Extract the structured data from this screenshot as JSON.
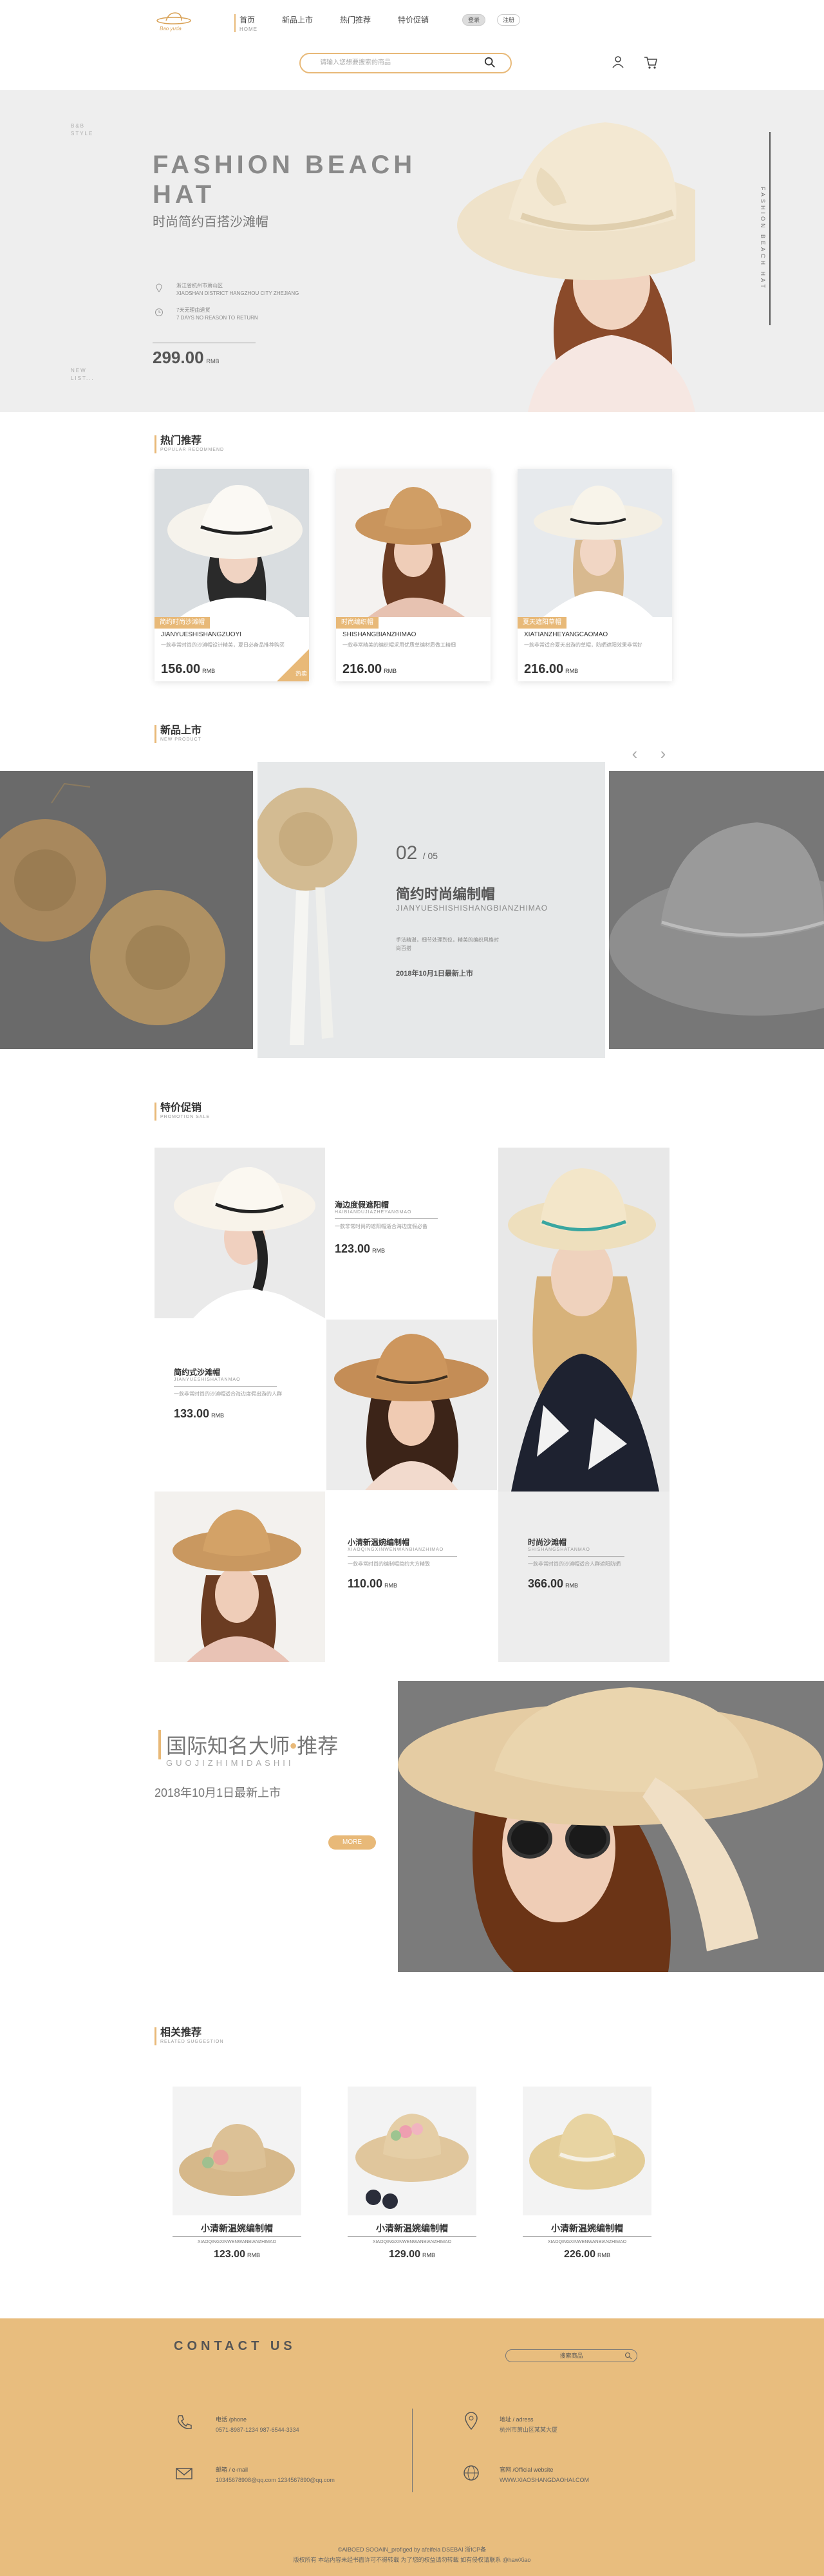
{
  "header": {
    "logo_text": "Bao yuda",
    "nav": [
      {
        "label": "首页",
        "sub": "HOME"
      },
      {
        "label": "新品上市"
      },
      {
        "label": "热门推荐"
      },
      {
        "label": "特价促销"
      }
    ],
    "lang": [
      "登录",
      "注册"
    ],
    "search_placeholder": "请输入您想要搜索的商品"
  },
  "hero": {
    "side_top": "B&B STYLE",
    "side_bottom": "NEW LIST...",
    "title": "FASHION BEACH HAT",
    "subtitle": "时尚简约百搭沙滩帽",
    "meta1_cn": "浙江省杭州市萧山区",
    "meta1_en": "XIAOSHAN DISTRICT HANGZHOU CITY ZHEJIANG",
    "meta2_cn": "7天无理由退货",
    "meta2_en": "7 DAYS NO REASON TO RETURN",
    "price": "299.00",
    "currency": "RMB",
    "vertical": "FASHION BEACH HAT"
  },
  "hot": {
    "title": "热门推荐",
    "sub": "POPULAR RECOMMEND",
    "cards": [
      {
        "tag": "简约时尚沙滩帽",
        "name": "JIANYUESHISHANGZUOYI",
        "desc": "一款非常时尚的沙滩帽设计精美，夏日必备品推荐购买",
        "price": "156.00",
        "corner": "热卖"
      },
      {
        "tag": "时尚编织帽",
        "name": "SHISHANGBIANZHIMAO",
        "desc": "一款非常精美的编织帽采用优质草编材质做工精细",
        "price": "216.00"
      },
      {
        "tag": "夏天遮阳草帽",
        "name": "XIATIANZHEYANGCAOMAO",
        "desc": "一款非常适合夏天出游的草帽，防晒遮阳效果非常好",
        "price": "216.00"
      }
    ],
    "currency": "RMB"
  },
  "newp": {
    "title": "新品上市",
    "sub": "NEW PRODUCT",
    "index": "02",
    "total": "/ 05",
    "name": "简约时尚编制帽",
    "pinyin": "JIANYUESHISHISHANGBIANZHIMAO",
    "desc": "手法精湛，细节处理到位，精美的编织风格时尚百搭",
    "date": "2018年10月1日最新上市",
    "arrow_prev": "‹",
    "arrow_next": "›"
  },
  "promo": {
    "title": "特价促销",
    "sub": "PROMOTION SALE",
    "items": [
      {
        "name": "海边度假遮阳帽",
        "pinyin": "HAIBIANDUJIAZHEYANGMAO",
        "desc": "一款非常时尚的遮阳帽适合海边度假必备",
        "price": "123.00"
      },
      {
        "name": "简约式沙滩帽",
        "pinyin": "JIANYUESHISHATANMAO",
        "desc": "一款非常时尚的沙滩帽适合海边度假出游的人群",
        "price": "133.00"
      },
      {
        "name": "小清新温婉编制帽",
        "pinyin": "XIAOQINGXINWENWANBIANZHIMAO",
        "desc": "一款非常时尚的编制帽简约大方精致",
        "price": "110.00"
      },
      {
        "name": "时尚沙滩帽",
        "pinyin": "SHISHANGSHATANMAO",
        "desc": "一款非常时尚的沙滩帽适合人群遮阳防晒",
        "price": "366.00"
      }
    ],
    "currency": "RMB"
  },
  "designer": {
    "title_a": "国际知名大师",
    "title_b": "推荐",
    "pinyin": "GUOJIZHIMIDASHII",
    "date": "2018年10月1日最新上市",
    "more": "MORE"
  },
  "related": {
    "title": "相关推荐",
    "sub": "RELATED SUGGESTION",
    "items": [
      {
        "name": "小清新温婉编制帽",
        "pinyin": "XIAOQINGXINWENWANBIANZHIMAO",
        "price": "123.00"
      },
      {
        "name": "小清新温婉编制帽",
        "pinyin": "XIAOQINGXINWENWANBIANZHIMAO",
        "price": "129.00"
      },
      {
        "name": "小清新温婉编制帽",
        "pinyin": "XIAOQINGXINWENWANBIANZHIMAO",
        "price": "226.00"
      }
    ],
    "currency": "RMB"
  },
  "footer": {
    "title": "CONTACT US",
    "search_placeholder": "搜索商品",
    "phone_label": "电话 /phone",
    "phone_value": "0571-8987-1234    987-6544-3334",
    "address_label": "地址 / adress",
    "address_value": "杭州市萧山区某某大厦",
    "email_label": "邮箱 / e-mail",
    "email_value": "10345678908@qq.com    1234567890@qq.com",
    "web_label": "官网 /Official website",
    "web_value": "WWW.XIAOSHANGDAOHAI.COM",
    "bottom1": "©AIBOED SOOAIN_profiged by afeifeia DSEBAI 浙ICP备",
    "bottom2": "版权所有 本站内容未经书面许可不得转载 为了您的权益请勿转载 如有侵权请联系 @hawXiao",
    "colors": {
      "accent": "#e8b978",
      "footer": "#e8bd7e"
    }
  }
}
